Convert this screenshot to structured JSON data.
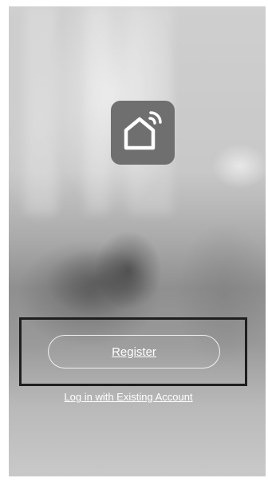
{
  "app": {
    "icon": "smart-home-icon",
    "icon_bg_color": "#6f6f6f"
  },
  "actions": {
    "register_label": "Register",
    "login_label": "Log in with Existing Account"
  },
  "colors": {
    "button_text": "#ffffff",
    "highlight_border": "#1e1e1e"
  }
}
